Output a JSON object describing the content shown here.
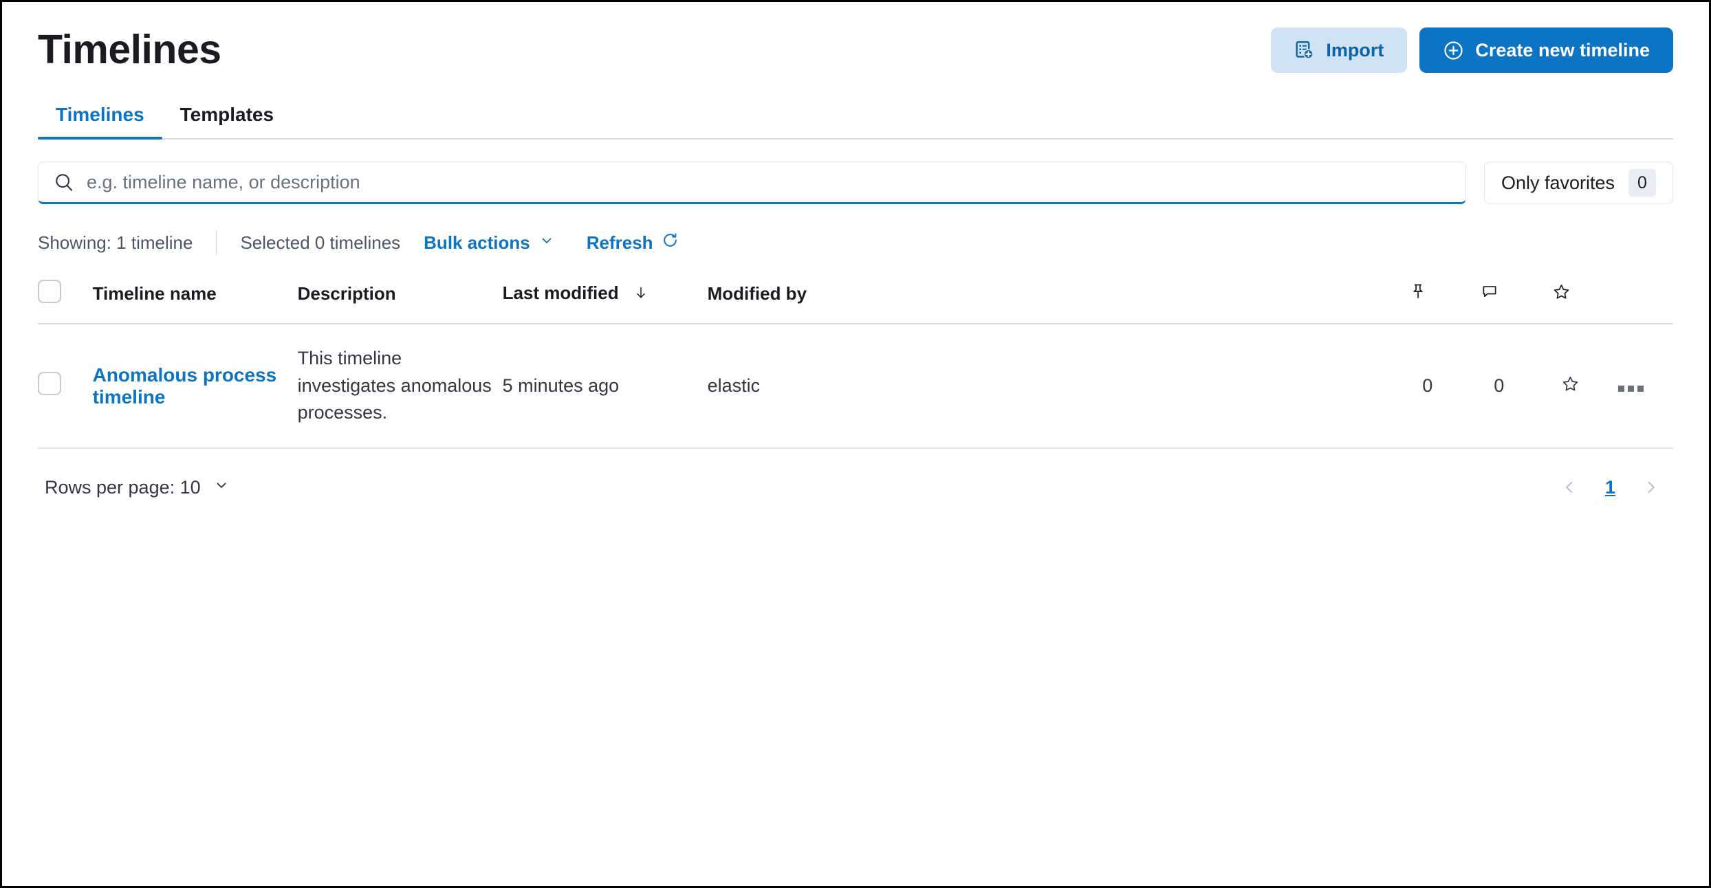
{
  "header": {
    "title": "Timelines",
    "import_label": "Import",
    "create_label": "Create new timeline"
  },
  "tabs": [
    {
      "label": "Timelines",
      "active": true
    },
    {
      "label": "Templates",
      "active": false
    }
  ],
  "search": {
    "placeholder": "e.g. timeline name, or description",
    "value": ""
  },
  "favorites_filter": {
    "label": "Only favorites",
    "count": "0"
  },
  "utility_bar": {
    "showing": "Showing: 1 timeline",
    "selected": "Selected 0 timelines",
    "bulk_actions": "Bulk actions",
    "refresh": "Refresh"
  },
  "table": {
    "columns": {
      "name": "Timeline name",
      "description": "Description",
      "last_modified": "Last modified",
      "modified_by": "Modified by",
      "pinned_icon": "pin-icon",
      "notes_icon": "comment-icon",
      "favorite_icon": "star-icon"
    },
    "sort": {
      "column": "Last modified",
      "direction": "desc"
    },
    "rows": [
      {
        "name": "Anomalous process timeline",
        "description": "This timeline investigates anomalous processes.",
        "last_modified": "5 minutes ago",
        "modified_by": "elastic",
        "pinned_count": "0",
        "notes_count": "0",
        "favorite": false
      }
    ]
  },
  "footer": {
    "rows_per_page_label": "Rows per page: 10",
    "current_page": "1"
  },
  "colors": {
    "accent": "#0b74c4",
    "import_bg": "#cfe3f5",
    "text": "#1a1c21",
    "muted": "#6a717d"
  }
}
